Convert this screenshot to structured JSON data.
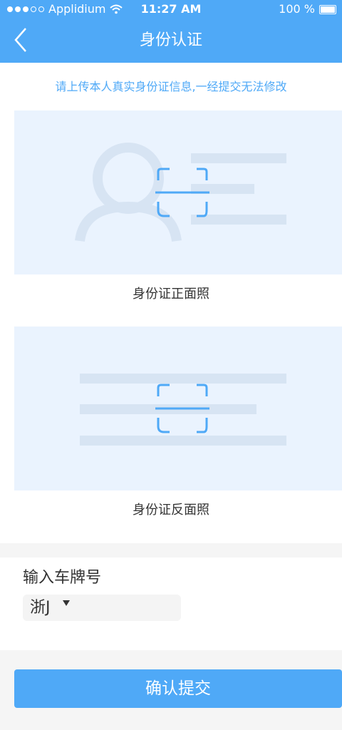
{
  "status_bar": {
    "carrier": "Applidium",
    "time": "11:27 AM",
    "battery": "100 %"
  },
  "nav": {
    "title": "身份认证"
  },
  "notice": "请上传本人真实身份证信息,一经提交无法修改",
  "front": {
    "caption": "身份证正面照"
  },
  "back": {
    "caption": "身份证反面照"
  },
  "plate": {
    "label": "输入车牌号",
    "value": "浙J"
  },
  "submit_label": "确认提交",
  "colors": {
    "accent": "#4fa9f7",
    "card_bg": "#eaf3fe",
    "placeholder_shape": "#d7e4f3"
  }
}
